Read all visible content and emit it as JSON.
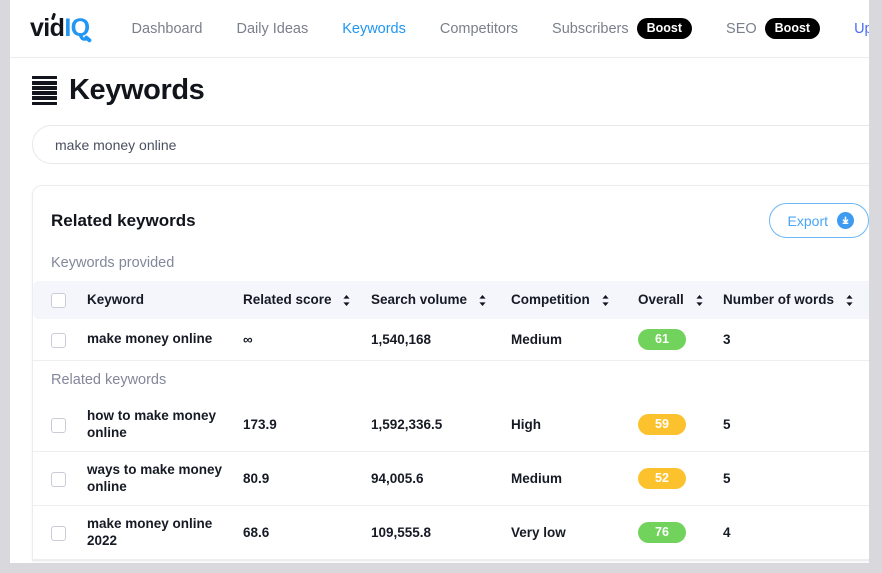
{
  "navbar": {
    "logo": {
      "part1": "vid",
      "part2": "IQ"
    },
    "links": [
      {
        "label": "Dashboard",
        "active": false,
        "boost": null
      },
      {
        "label": "Daily Ideas",
        "active": false,
        "boost": null
      },
      {
        "label": "Keywords",
        "active": true,
        "boost": null
      },
      {
        "label": "Competitors",
        "active": false,
        "boost": null
      },
      {
        "label": "Subscribers",
        "active": false,
        "boost": "Boost"
      },
      {
        "label": "SEO",
        "active": false,
        "boost": "Boost"
      },
      {
        "label": "Upgra",
        "active": false,
        "boost": null
      }
    ],
    "active_color": "#2196f3",
    "upgrade_color": "#4a6cf7"
  },
  "page": {
    "title": "Keywords",
    "icon": "stack-lines-icon"
  },
  "search": {
    "value": "make money online",
    "placeholder": "make money online"
  },
  "card": {
    "title": "Related keywords",
    "export_label": "Export",
    "export_icon": "download-circle-icon",
    "sections": {
      "provided": "Keywords provided",
      "related": "Related keywords"
    },
    "columns": [
      {
        "label": "Keyword",
        "sortable": false
      },
      {
        "label": "Related score",
        "sortable": true
      },
      {
        "label": "Search volume",
        "sortable": true
      },
      {
        "label": "Competition",
        "sortable": true
      },
      {
        "label": "Overall",
        "sortable": true
      },
      {
        "label": "Number of words",
        "sortable": true
      }
    ],
    "provided_rows": [
      {
        "keyword": "make money online",
        "related_score": "∞",
        "search_volume": "1,540,168",
        "competition": "Medium",
        "overall": "61",
        "overall_color": "green",
        "number_of_words": "3"
      }
    ],
    "related_rows": [
      {
        "keyword": "how to make money online",
        "related_score": "173.9",
        "search_volume": "1,592,336.5",
        "competition": "High",
        "overall": "59",
        "overall_color": "orange",
        "number_of_words": "5"
      },
      {
        "keyword": "ways to make money online",
        "related_score": "80.9",
        "search_volume": "94,005.6",
        "competition": "Medium",
        "overall": "52",
        "overall_color": "orange",
        "number_of_words": "5"
      },
      {
        "keyword": "make money online 2022",
        "related_score": "68.6",
        "search_volume": "109,555.8",
        "competition": "Very low",
        "overall": "76",
        "overall_color": "green",
        "number_of_words": "4"
      }
    ]
  },
  "colors": {
    "green_badge": "#72d35c",
    "orange_badge": "#fcc22e",
    "accent_blue": "#2196f3",
    "page_background": "#d9d9dd"
  }
}
